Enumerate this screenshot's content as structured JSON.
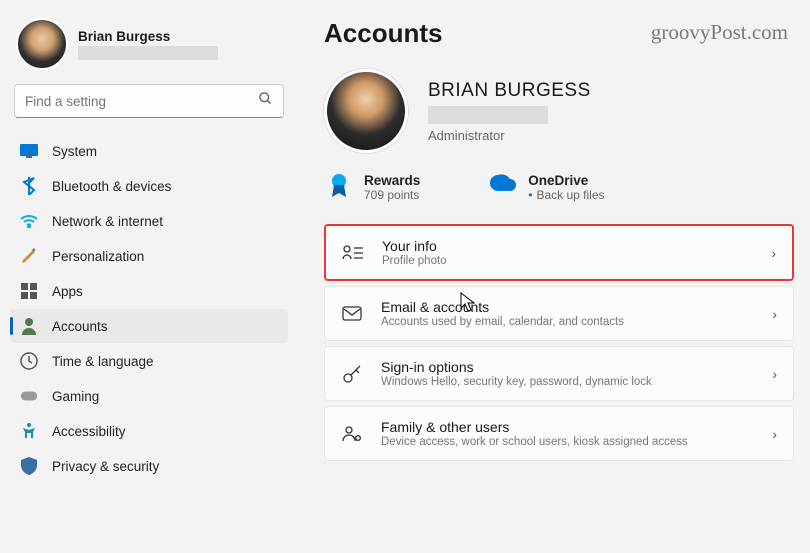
{
  "watermark": "groovyPost.com",
  "user": {
    "name": "Brian Burgess"
  },
  "search": {
    "placeholder": "Find a setting"
  },
  "nav": [
    {
      "key": "system",
      "label": "System"
    },
    {
      "key": "bluetooth",
      "label": "Bluetooth & devices"
    },
    {
      "key": "network",
      "label": "Network & internet"
    },
    {
      "key": "personalization",
      "label": "Personalization"
    },
    {
      "key": "apps",
      "label": "Apps"
    },
    {
      "key": "accounts",
      "label": "Accounts"
    },
    {
      "key": "time",
      "label": "Time & language"
    },
    {
      "key": "gaming",
      "label": "Gaming"
    },
    {
      "key": "accessibility",
      "label": "Accessibility"
    },
    {
      "key": "privacy",
      "label": "Privacy & security"
    }
  ],
  "page": {
    "title": "Accounts",
    "profile_name": "BRIAN BURGESS",
    "profile_role": "Administrator"
  },
  "status": {
    "rewards": {
      "title": "Rewards",
      "sub": "709 points"
    },
    "onedrive": {
      "title": "OneDrive",
      "sub": "Back up files"
    }
  },
  "cards": {
    "yourinfo": {
      "title": "Your info",
      "sub": "Profile photo"
    },
    "email": {
      "title": "Email & accounts",
      "sub": "Accounts used by email, calendar, and contacts"
    },
    "signin": {
      "title": "Sign-in options",
      "sub": "Windows Hello, security key, password, dynamic lock"
    },
    "family": {
      "title": "Family & other users",
      "sub": "Device access, work or school users, kiosk assigned access"
    }
  }
}
